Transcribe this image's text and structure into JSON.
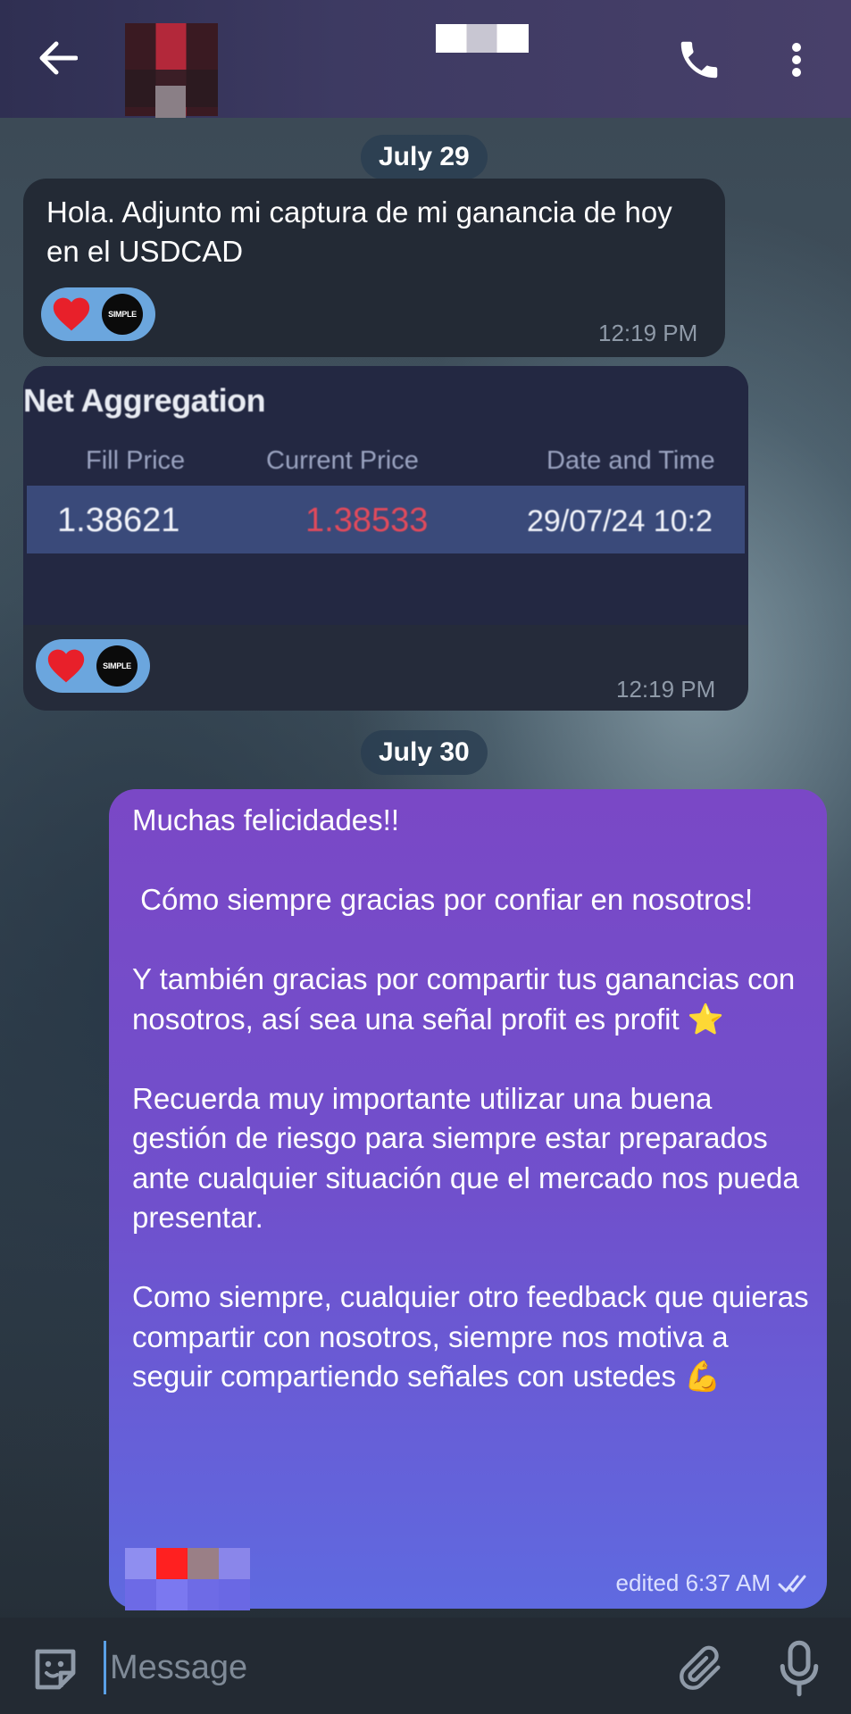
{
  "header": {
    "back_icon": "arrow-left-icon",
    "title": "",
    "call_icon": "phone-icon",
    "more_icon": "more-vertical-icon",
    "background": "#3a3860"
  },
  "messages": [
    {
      "type": "date",
      "label": "July 29"
    },
    {
      "type": "incoming_text",
      "text": "Hola. Adjunto mi captura de mi ganancia de hoy en el USDCAD",
      "reactions": [
        "heart-icon",
        "SIMPLE"
      ],
      "time": "12:19 PM"
    },
    {
      "type": "incoming_image",
      "image": {
        "title": "Net Aggregation",
        "columns": [
          "Fill Price",
          "Current Price",
          "Date and Time"
        ],
        "row": [
          "1.38621",
          "1.38533",
          "29/07/24 10:2"
        ]
      },
      "reactions": [
        "heart-icon",
        "SIMPLE"
      ],
      "time": "12:19 PM"
    },
    {
      "type": "date",
      "label": "July 30"
    },
    {
      "type": "outgoing_text",
      "paragraphs": [
        "Muchas felicidades!!",
        " Cómo siempre gracias por confiar en nosotros!",
        "Y también gracias por compartir tus ganancias con nosotros, así sea una señal profit es profit ⭐",
        "Recuerda muy importante utilizar una buena gestión de riesgo para siempre estar preparados ante cualquier situación que el mercado nos pueda presentar.",
        "Como siempre, cualquier otro feedback que quieras compartir con nosotros, siempre nos motiva a seguir compartiendo señales con ustedes 💪"
      ],
      "meta": "edited 6:37 AM",
      "status_icon": "double-check-icon",
      "gradient": [
        "#7a48c6",
        "#5f6ae0"
      ]
    }
  ],
  "input_bar": {
    "emoji_icon": "sticker-emoji-icon",
    "placeholder": "Message",
    "attach_icon": "paperclip-icon",
    "mic_icon": "microphone-icon"
  },
  "colors": {
    "incoming_bubble": "#232a35",
    "reaction_pill": "#6ba6de",
    "accent": "#5aa0e6",
    "price_down": "#e04a5c"
  }
}
